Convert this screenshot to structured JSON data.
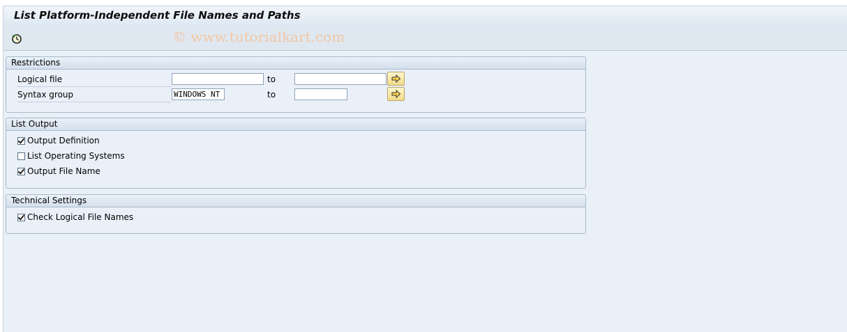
{
  "window": {
    "title": "List Platform-Independent File Names and Paths",
    "watermark": "© www.tutorialkart.com"
  },
  "toolbar": {
    "execute_icon": "execute-clock-icon"
  },
  "restrictions": {
    "header": "Restrictions",
    "logical_file": {
      "label": "Logical file",
      "from": "",
      "to_label": "to",
      "to": ""
    },
    "syntax_group": {
      "label": "Syntax group",
      "from": "WINDOWS NT",
      "to_label": "to",
      "to": ""
    },
    "multi_select_icon": "multiple-selection-arrow-icon"
  },
  "list_output": {
    "header": "List Output",
    "options": [
      {
        "label": "Output Definition",
        "checked": true
      },
      {
        "label": "List Operating Systems",
        "checked": false
      },
      {
        "label": "Output File Name",
        "checked": true
      }
    ]
  },
  "technical_settings": {
    "header": "Technical Settings",
    "options": [
      {
        "label": "Check Logical File Names",
        "checked": true
      }
    ]
  },
  "colors": {
    "background": "#e9f0f8",
    "group_border": "#a9b9cb",
    "button_yellow": "#f2dc8a"
  }
}
